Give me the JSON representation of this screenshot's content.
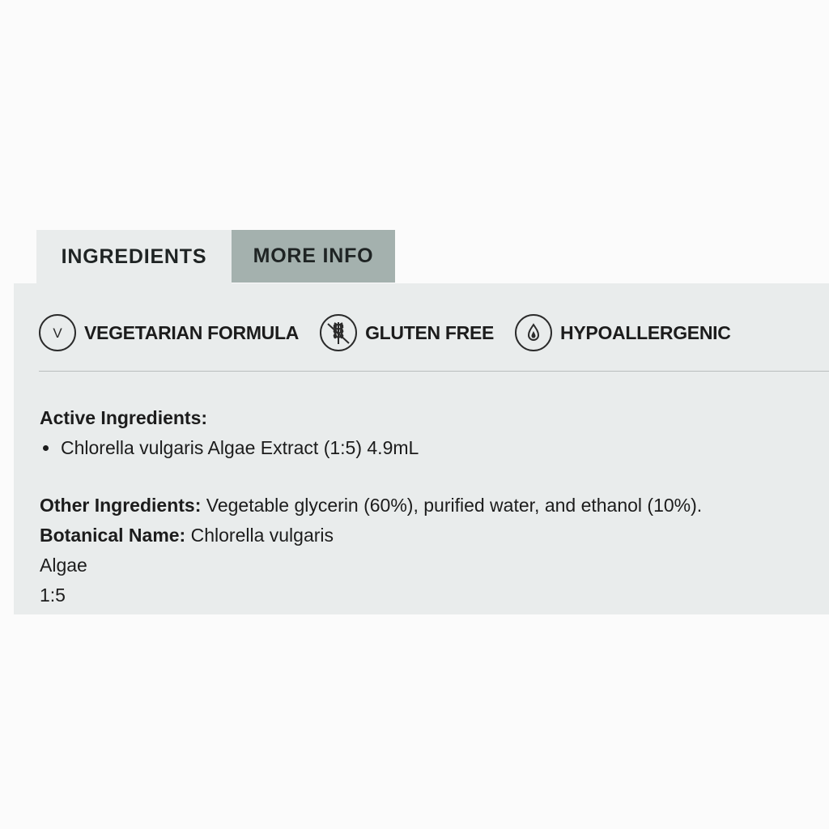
{
  "tabs": [
    {
      "label": "INGREDIENTS",
      "active": true
    },
    {
      "label": "MORE INFO",
      "active": false
    }
  ],
  "badges": [
    {
      "icon": "vegetarian-v-icon",
      "glyph": "V",
      "label": "VEGETARIAN FORMULA"
    },
    {
      "icon": "gluten-free-wheat-icon",
      "label": "GLUTEN FREE"
    },
    {
      "icon": "hypoallergenic-drop-icon",
      "label": "HYPOALLERGENIC"
    }
  ],
  "active_ingredients": {
    "heading": "Active Ingredients:",
    "items": [
      "Chlorella vulgaris Algae Extract (1:5) 4.9mL"
    ]
  },
  "other_ingredients": {
    "label": "Other Ingredients:",
    "value": " Vegetable glycerin (60%), purified water, and ethanol (10%)."
  },
  "botanical_name": {
    "label": "Botanical Name:",
    "value": " Chlorella vulgaris"
  },
  "plant_part": "Algae",
  "ratio": "1:5",
  "colors": {
    "page_background": "#fbfbfb",
    "panel_background": "#e9ecec",
    "inactive_tab": "#a4b1ae",
    "text": "#1c1c1c"
  }
}
